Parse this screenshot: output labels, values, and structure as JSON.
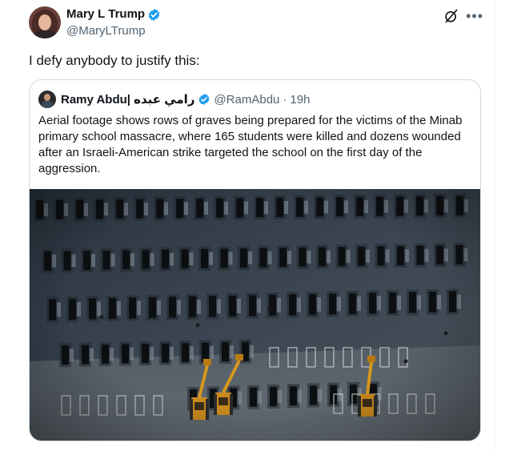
{
  "author": {
    "display_name": "Mary L Trump",
    "handle": "@MaryLTrump"
  },
  "tweet": {
    "text": "I defy anybody to justify this:"
  },
  "quoted": {
    "display_name": "Ramy Abdu| رامي عبده",
    "handle": "@RamAbdu",
    "separator": "·",
    "time": "19h",
    "text": "Aerial footage shows rows of graves being prepared for the victims of the Minab primary school massacre, where 165 students were killed and dozens wounded after an Israeli-American strike targeted the school on the first day of the aggression."
  },
  "icons": {
    "verified": "verified-badge-icon",
    "grok": "grok-icon",
    "more": "more-icon"
  },
  "colors": {
    "verified_blue": "#1d9bf0",
    "secondary_text": "#536471",
    "border": "#cfd9de"
  }
}
